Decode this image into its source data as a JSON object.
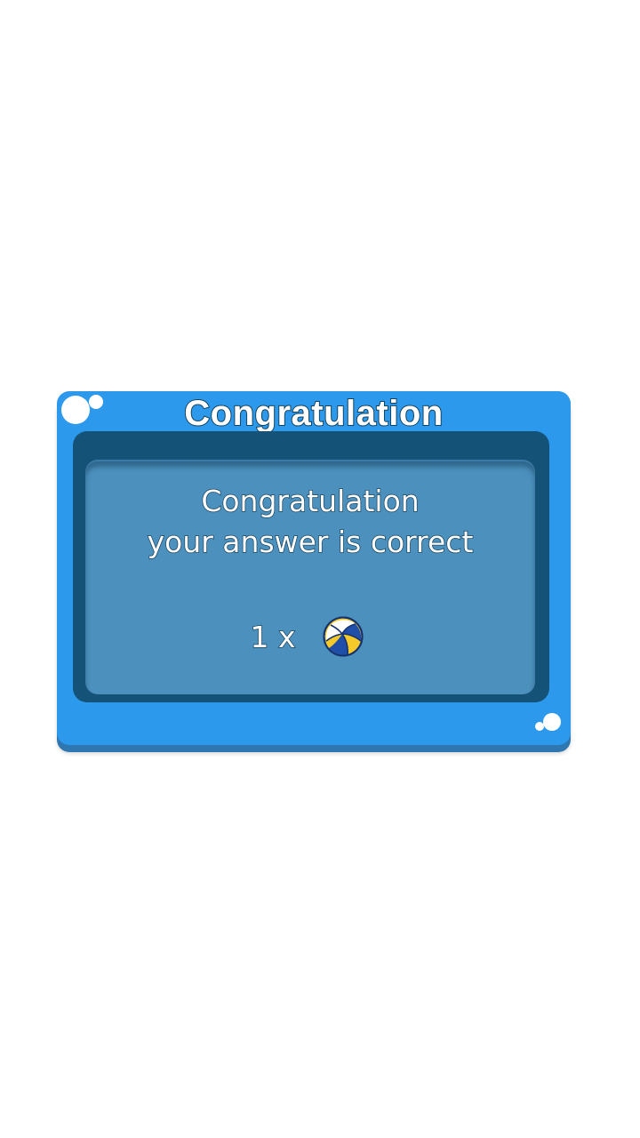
{
  "dialog": {
    "title": "Congratulation",
    "message_line1": "Congratulation",
    "message_line2": "your answer is correct",
    "reward": {
      "count_label": "1 x",
      "icon": "volleyball-icon"
    }
  },
  "colors": {
    "frame": "#2c99ec",
    "panel_dark": "#155277",
    "panel_light": "#4c90bd",
    "ball_yellow": "#f6c92b",
    "ball_blue": "#1f4fa8"
  }
}
